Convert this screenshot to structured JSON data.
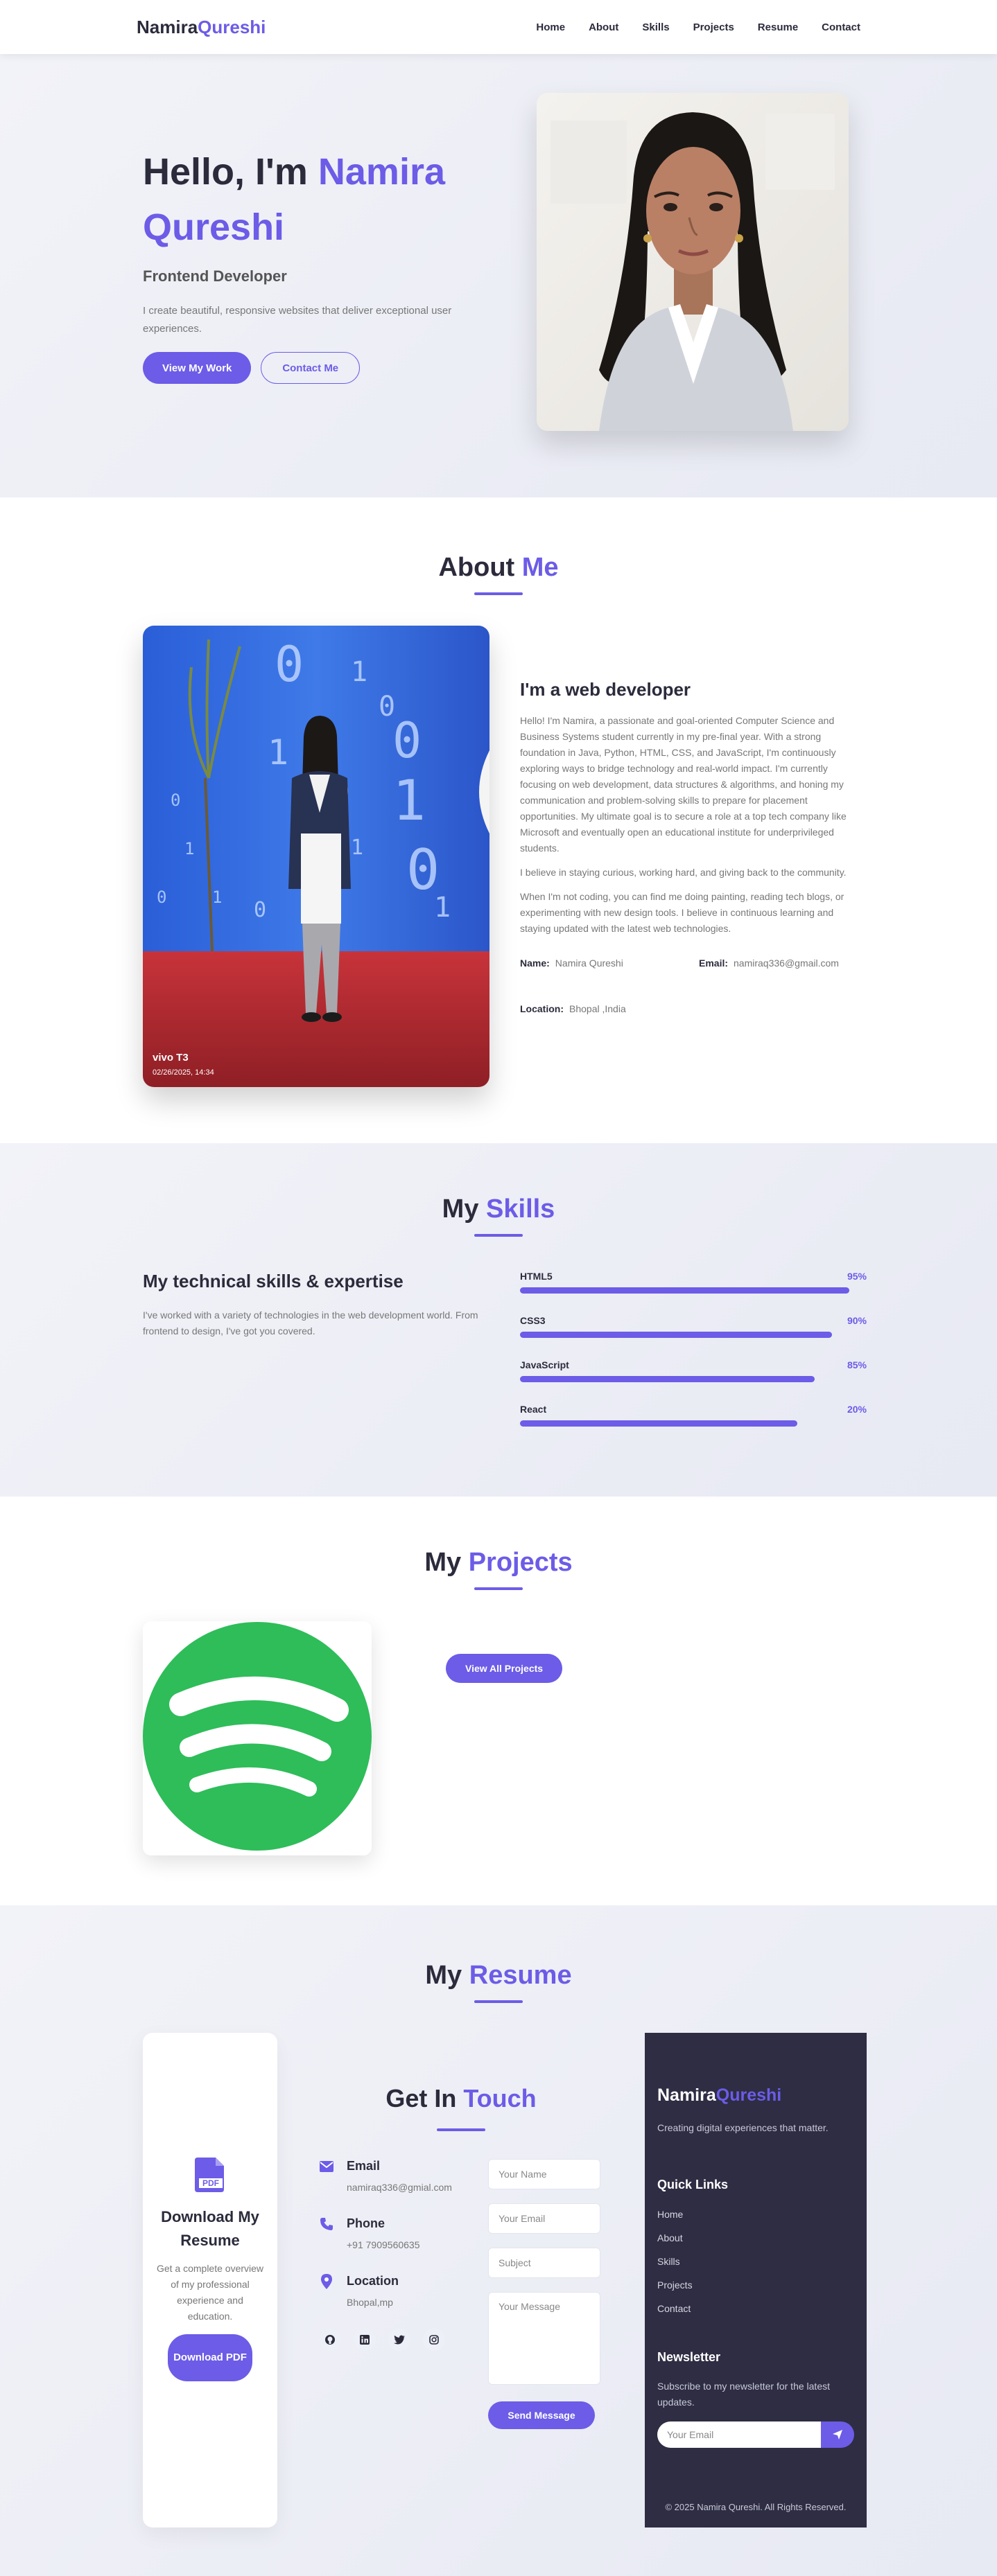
{
  "nav": {
    "logo_first": "Namira",
    "logo_last": "Qureshi",
    "links": [
      "Home",
      "About",
      "Skills",
      "Projects",
      "Resume",
      "Contact"
    ]
  },
  "hero": {
    "greeting": "Hello, I'm",
    "name": "Namira Qureshi",
    "role": "Frontend Developer",
    "description": "I create beautiful, responsive websites that deliver exceptional user experiences.",
    "primary_btn": "View My Work",
    "secondary_btn": "Contact Me"
  },
  "about": {
    "title_plain": "About",
    "title_accent": "Me",
    "photo_caption_brand": "vivo T3",
    "photo_caption_date": "02/26/2025, 14:34",
    "heading": "I'm a web developer",
    "paragraphs": [
      "Hello! I'm Namira, a passionate and goal-oriented Computer Science and Business Systems student currently in my pre-final year. With a strong foundation in Java, Python, HTML, CSS, and JavaScript, I'm continuously exploring ways to bridge technology and real-world impact. I'm currently focusing on web development, data structures & algorithms, and honing my communication and problem-solving skills to prepare for placement opportunities. My ultimate goal is to secure a role at a top tech company like Microsoft and eventually open an educational institute for underprivileged students.",
      "I believe in staying curious, working hard, and giving back to the community.",
      "When I'm not coding, you can find me doing painting, reading tech blogs, or experimenting with new design tools. I believe in continuous learning and staying updated with the latest web technologies."
    ],
    "info": {
      "name_label": "Name:",
      "name_value": "Namira Qureshi",
      "email_label": "Email:",
      "email_value": "namiraq336@gmail.com",
      "location_label": "Location:",
      "location_value": "Bhopal ,India"
    }
  },
  "skills": {
    "title_plain": "My",
    "title_accent": "Skills",
    "heading": "My technical skills & expertise",
    "description": "I've worked with a variety of technologies in the web development world. From frontend to design, I've got you covered.",
    "items": [
      {
        "name": "HTML5",
        "percent_label": "95%",
        "fill": 0.95
      },
      {
        "name": "CSS3",
        "percent_label": "90%",
        "fill": 0.9
      },
      {
        "name": "JavaScript",
        "percent_label": "85%",
        "fill": 0.85
      },
      {
        "name": "React",
        "percent_label": "20%",
        "fill": 0.8
      }
    ],
    "accent_color": "#6c5ce7"
  },
  "projects": {
    "title_plain": "My",
    "title_accent": "Projects",
    "view_all_btn": "View All Projects"
  },
  "resume": {
    "title_plain": "My",
    "title_accent": "Resume",
    "download_heading": "Download My Resume",
    "download_desc": "Get a complete overview of my professional experience and education.",
    "download_btn": "Download PDF",
    "pdf_icon_label": "PDF"
  },
  "contact": {
    "title_plain": "Get In",
    "title_accent": "Touch",
    "email_title": "Email",
    "email_value": "namiraq336@gmial.com",
    "phone_title": "Phone",
    "phone_value": "+91 7909560635",
    "location_title": "Location",
    "location_value": "Bhopal,mp",
    "social_icons": [
      "github-icon",
      "linkedin-icon",
      "twitter-icon",
      "instagram-icon"
    ],
    "form": {
      "name_placeholder": "Your Name",
      "email_placeholder": "Your Email",
      "subject_placeholder": "Subject",
      "message_placeholder": "Your Message",
      "send_btn": "Send Message"
    }
  },
  "footer": {
    "logo_first": "Namira",
    "logo_last": "Qureshi",
    "tagline": "Creating digital experiences that matter.",
    "quick_links_title": "Quick Links",
    "quick_links": [
      "Home",
      "About",
      "Skills",
      "Projects",
      "Contact"
    ],
    "newsletter_title": "Newsletter",
    "newsletter_desc": "Subscribe to my newsletter for the latest updates.",
    "newsletter_placeholder": "Your Email",
    "copyright": "© 2025 Namira Qureshi. All Rights Reserved."
  },
  "colors": {
    "accent": "#6c5ce7",
    "dark": "#2b2b3c",
    "footer_bg": "#2e2d43",
    "spotify_green": "#2ebd59"
  }
}
